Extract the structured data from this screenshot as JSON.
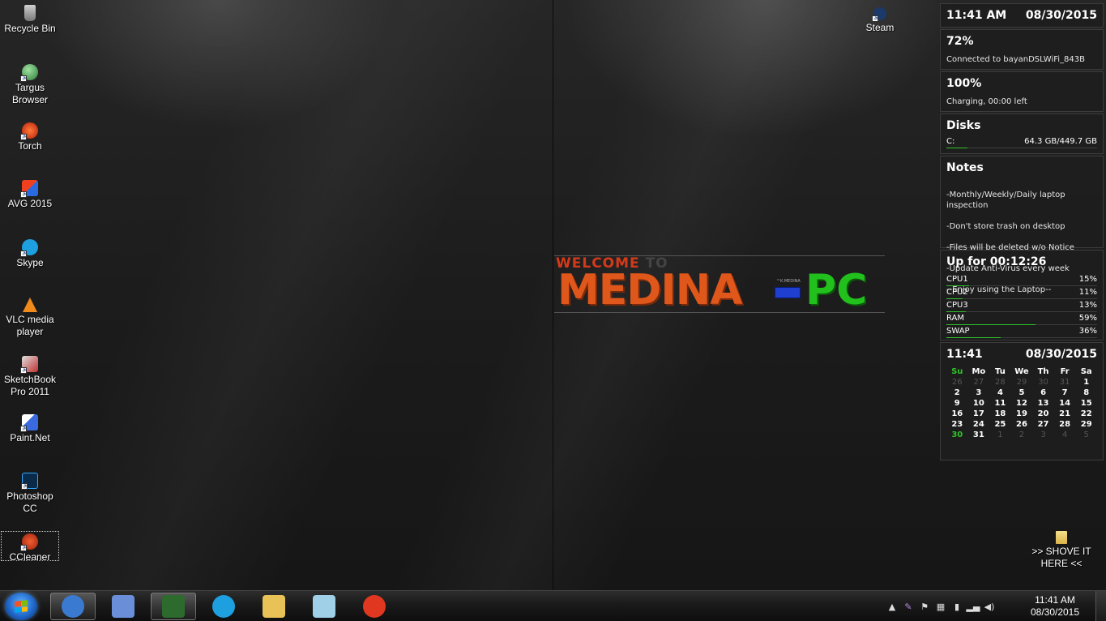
{
  "desktop": {
    "icons": [
      {
        "label": "Recycle Bin",
        "icon": "recycle-bin-icon"
      },
      {
        "label": "Targus Browser",
        "icon": "globe-icon"
      },
      {
        "label": "Torch",
        "icon": "torch-icon"
      },
      {
        "label": "AVG 2015",
        "icon": "avg-icon"
      },
      {
        "label": "Skype",
        "icon": "skype-icon"
      },
      {
        "label": "VLC media player",
        "icon": "vlc-cone-icon"
      },
      {
        "label": "SketchBook Pro 2011",
        "icon": "sketchbook-icon"
      },
      {
        "label": "Paint.Net",
        "icon": "paint-net-icon"
      },
      {
        "label": "Photoshop CC",
        "icon": "photoshop-icon"
      },
      {
        "label": "CCleaner",
        "icon": "ccleaner-icon"
      },
      {
        "label": "Steam",
        "icon": "steam-icon"
      },
      {
        "label": ">> SHOVE IT HERE <<",
        "icon": "folder-icon"
      }
    ]
  },
  "logo": {
    "welcome": "WELCOME",
    "to": "TO",
    "name": "MEDINA",
    "suffix": "PC",
    "tiny": "™K.MEDINA"
  },
  "gadgets": {
    "clock": {
      "time": "11:41 AM",
      "date": "08/30/2015"
    },
    "wifi": {
      "percent": "72%",
      "status": "Connected to bayanDSLWiFi_843B",
      "level": 0.72
    },
    "battery": {
      "percent": "100%",
      "status": "Charging, 00:00 left",
      "level": 1.0
    },
    "disks": {
      "title": "Disks",
      "drive": "C:",
      "usage": "64.3 GB/449.7 GB",
      "level": 0.14
    },
    "notes": {
      "title": "Notes",
      "lines": [
        "-Monthly/Weekly/Daily laptop inspection",
        "-Don't store trash on desktop",
        "-Files will be deleted w/o Notice",
        "-Update Anti-Virus every week",
        "--Enjoy using the Laptop--"
      ]
    },
    "system": {
      "uptime": "Up for 00:12:26",
      "rows": [
        {
          "label": "CPU1",
          "value": "15%",
          "level": 0.15
        },
        {
          "label": "CPU2",
          "value": "11%",
          "level": 0.11
        },
        {
          "label": "CPU3",
          "value": "13%",
          "level": 0.13
        },
        {
          "label": "RAM",
          "value": "59%",
          "level": 0.59
        },
        {
          "label": "SWAP",
          "value": "36%",
          "level": 0.36
        }
      ]
    },
    "calendar": {
      "time": "11:41",
      "date": "08/30/2015",
      "weekdays": [
        "Su",
        "Mo",
        "Tu",
        "We",
        "Th",
        "Fr",
        "Sa"
      ],
      "days": [
        [
          "26",
          "27",
          "28",
          "29",
          "30",
          "31",
          "1"
        ],
        [
          "2",
          "3",
          "4",
          "5",
          "6",
          "7",
          "8"
        ],
        [
          "9",
          "10",
          "11",
          "12",
          "13",
          "14",
          "15"
        ],
        [
          "16",
          "17",
          "18",
          "19",
          "20",
          "21",
          "22"
        ],
        [
          "23",
          "24",
          "25",
          "26",
          "27",
          "28",
          "29"
        ],
        [
          "30",
          "31",
          "1",
          "2",
          "3",
          "4",
          "5"
        ]
      ],
      "today": "30"
    }
  },
  "taskbar": {
    "pinned": [
      {
        "name": "ie-globe-icon",
        "color": "#3a7ad0"
      },
      {
        "name": "task-manager-icon",
        "color": "#6a8fd8"
      },
      {
        "name": "terminal-icon",
        "color": "#2d6a2d"
      },
      {
        "name": "skype-icon",
        "color": "#1ea0e0"
      },
      {
        "name": "file-explorer-icon",
        "color": "#e8c257"
      },
      {
        "name": "notepad-icon",
        "color": "#9fd0e8"
      },
      {
        "name": "torch-browser-icon",
        "color": "#e03820"
      }
    ],
    "clock_time": "11:41 AM",
    "clock_date": "08/30/2015"
  }
}
